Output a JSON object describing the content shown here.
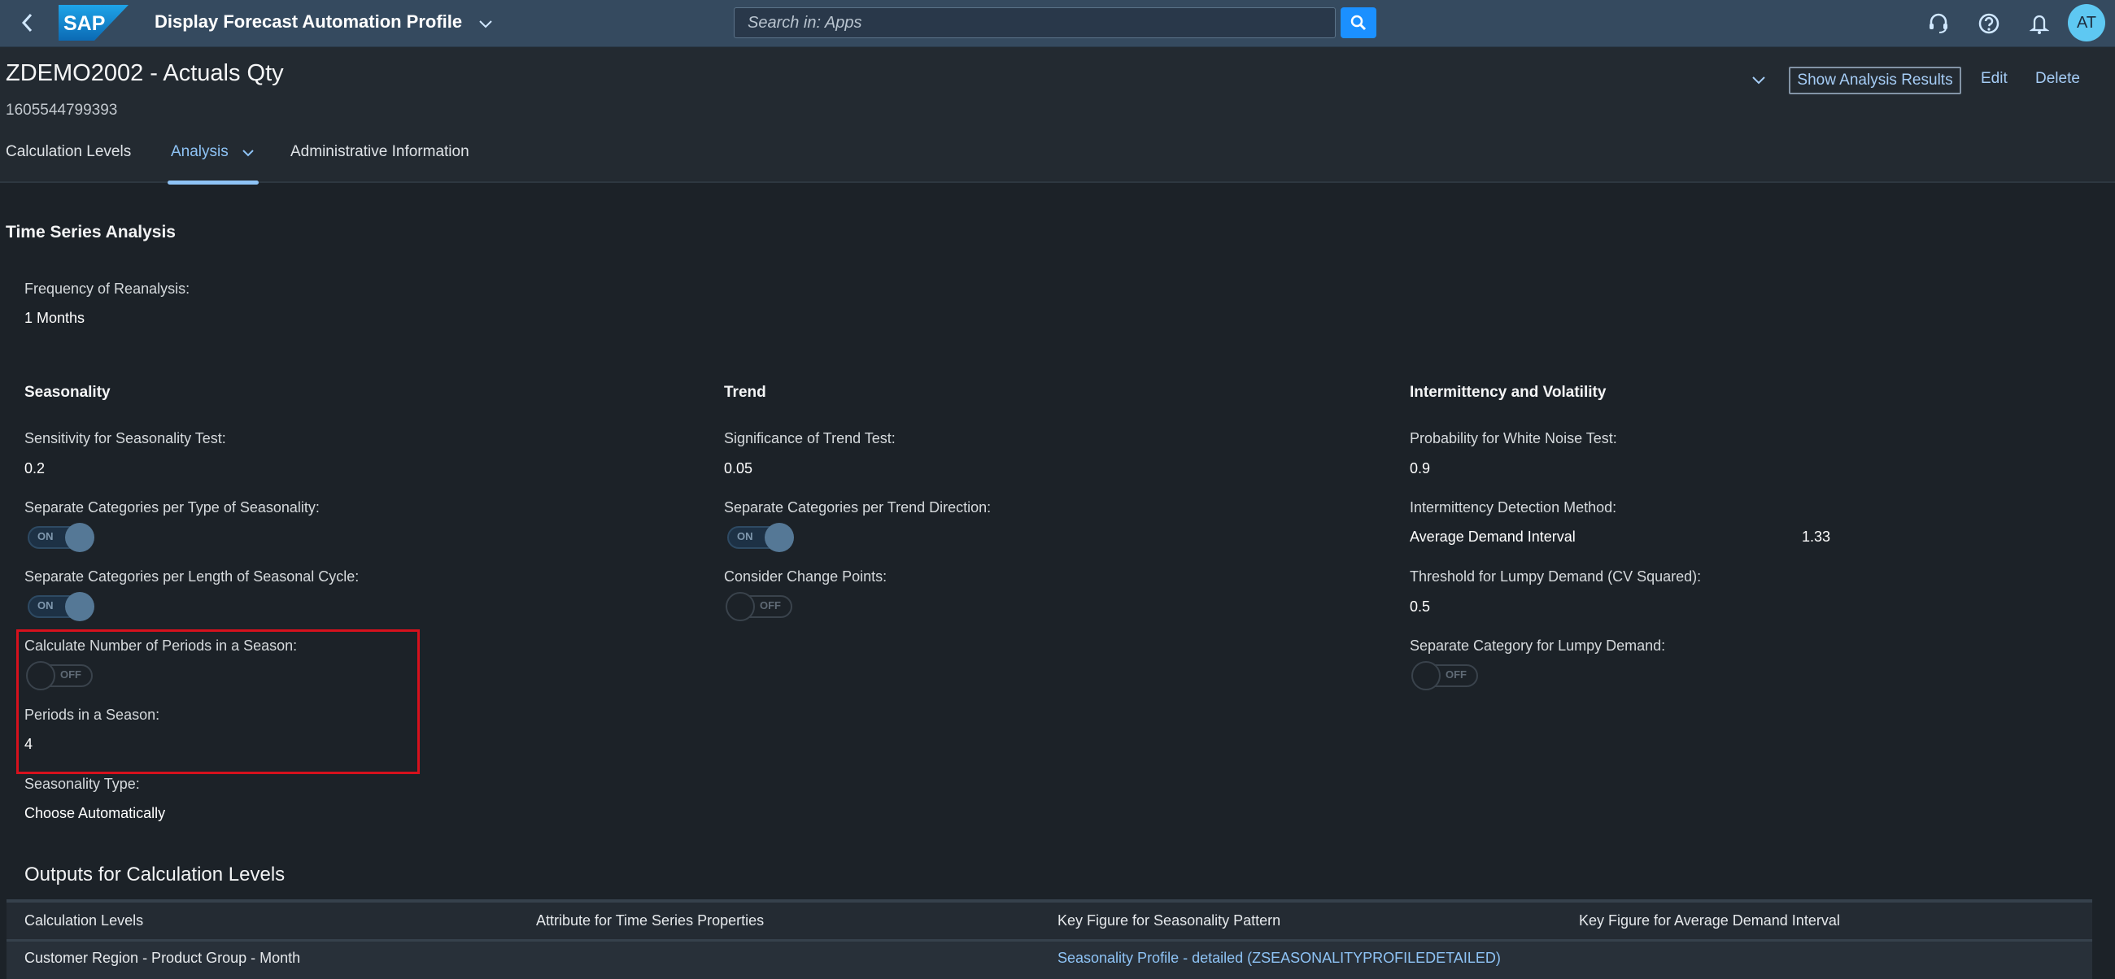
{
  "shell": {
    "logo_text": "SAP",
    "app_title": "Display Forecast Automation Profile",
    "search_placeholder": "Search in: Apps",
    "icons": [
      "back-icon",
      "chevron-down-icon",
      "search-icon",
      "headset-icon",
      "help-icon",
      "notification-bell-icon"
    ],
    "avatar_initials": "AT"
  },
  "header": {
    "title": "ZDEMO2002 - Actuals Qty",
    "subtitle": "1605544799393",
    "actions": {
      "show_analysis": "Show Analysis Results",
      "edit": "Edit",
      "delete": "Delete"
    },
    "tabs": [
      {
        "label": "Calculation Levels",
        "active": false
      },
      {
        "label": "Analysis",
        "active": true
      },
      {
        "label": "Administrative Information",
        "active": false
      }
    ]
  },
  "time_series": {
    "title": "Time Series Analysis",
    "frequency": {
      "label": "Frequency of Reanalysis:",
      "value": "1 Months"
    },
    "seasonality": {
      "title": "Seasonality",
      "sensitivity": {
        "label": "Sensitivity for Seasonality Test:",
        "value": "0.2"
      },
      "sep_type": {
        "label": "Separate Categories per Type of Seasonality:",
        "state": "ON"
      },
      "sep_length": {
        "label": "Separate Categories per Length of Seasonal Cycle:",
        "state": "ON"
      },
      "calc_periods": {
        "label": "Calculate Number of Periods in a Season:",
        "state": "OFF"
      },
      "periods": {
        "label": "Periods in a Season:",
        "value": "4"
      },
      "type": {
        "label": "Seasonality Type:",
        "value": "Choose Automatically"
      }
    },
    "trend": {
      "title": "Trend",
      "significance": {
        "label": "Significance of Trend Test:",
        "value": "0.05"
      },
      "sep_direction": {
        "label": "Separate Categories per Trend Direction:",
        "state": "ON"
      },
      "change_points": {
        "label": "Consider Change Points:",
        "state": "OFF"
      }
    },
    "intermittency": {
      "title": "Intermittency and Volatility",
      "white_noise": {
        "label": "Probability for White Noise Test:",
        "value": "0.9"
      },
      "detection": {
        "label": "Intermittency Detection Method:",
        "method": "Average Demand Interval",
        "value": "1.33"
      },
      "lumpy_threshold": {
        "label": "Threshold for Lumpy Demand (CV Squared):",
        "value": "0.5"
      },
      "sep_lumpy": {
        "label": "Separate Category for Lumpy Demand:",
        "state": "OFF"
      }
    }
  },
  "outputs": {
    "title": "Outputs for Calculation Levels",
    "columns": [
      "Calculation Levels",
      "Attribute for Time Series Properties",
      "Key Figure for Seasonality Pattern",
      "Key Figure for Average Demand Interval"
    ],
    "rows": [
      [
        "Customer Region - Product Group - Month",
        "",
        "Seasonality Profile - detailed (ZSEASONALITYPROFILEDETAILED)",
        ""
      ]
    ]
  }
}
